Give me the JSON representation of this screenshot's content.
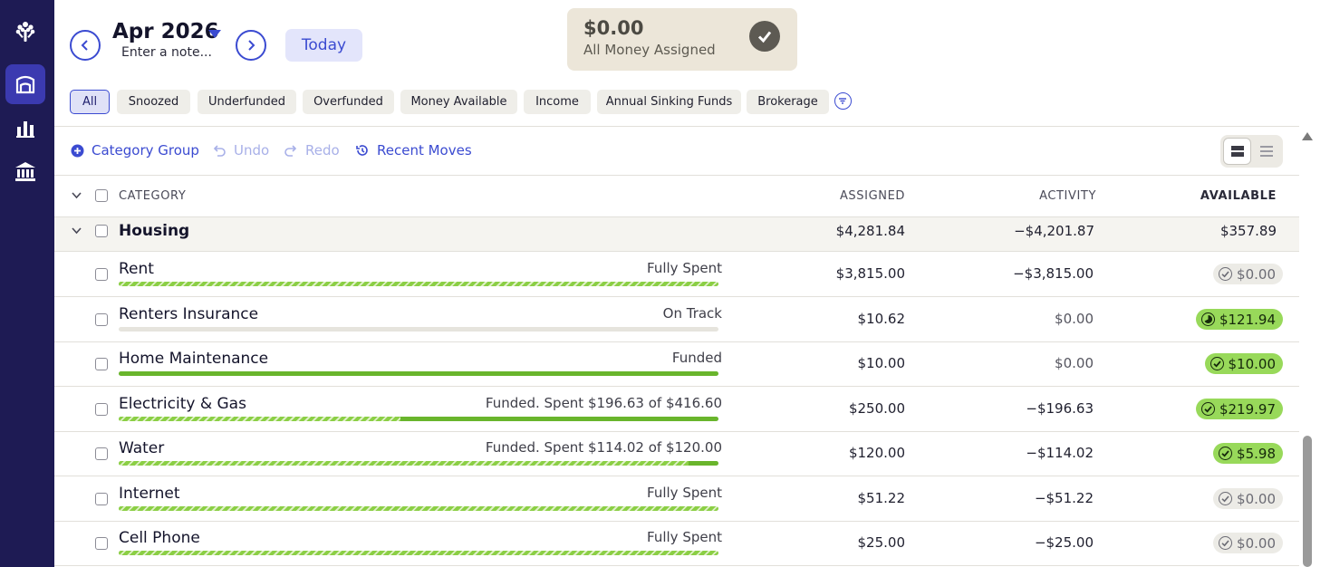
{
  "sidebar": {
    "items": [
      {
        "icon": "tree-logo-icon",
        "active": false
      },
      {
        "icon": "budget-icon",
        "active": true
      },
      {
        "icon": "reports-icon",
        "active": false
      },
      {
        "icon": "bank-icon",
        "active": false
      }
    ]
  },
  "header": {
    "month": "Apr 2026",
    "note_placeholder": "Enter a note...",
    "today_label": "Today",
    "assigned_amount": "$0.00",
    "assigned_label": "All Money Assigned"
  },
  "filters": [
    {
      "label": "All",
      "active": true
    },
    {
      "label": "Snoozed",
      "active": false
    },
    {
      "label": "Underfunded",
      "active": false
    },
    {
      "label": "Overfunded",
      "active": false
    },
    {
      "label": "Money Available",
      "active": false
    },
    {
      "label": "Income",
      "active": false
    },
    {
      "label": "Annual Sinking Funds",
      "active": false
    },
    {
      "label": "Brokerage",
      "active": false
    }
  ],
  "toolbar": {
    "category_group": "Category Group",
    "undo": "Undo",
    "redo": "Redo",
    "recent_moves": "Recent Moves"
  },
  "table": {
    "headers": {
      "category": "CATEGORY",
      "assigned": "ASSIGNED",
      "activity": "ACTIVITY",
      "available": "AVAILABLE"
    },
    "group": {
      "name": "Housing",
      "assigned": "$4,281.84",
      "activity": "−$4,201.87",
      "available": "$357.89"
    },
    "rows": [
      {
        "name": "Rent",
        "status": "Fully Spent",
        "assigned": "$3,815.00",
        "activity": "−$3,815.00",
        "available": "$0.00",
        "pill": "gray",
        "progress_striped": 1.0,
        "progress_solid": 0.0
      },
      {
        "name": "Renters Insurance",
        "status": "On Track",
        "assigned": "$10.62",
        "activity": "$0.00",
        "available": "$121.94",
        "pill": "green",
        "progress_striped": 0.0,
        "progress_solid": 0.0
      },
      {
        "name": "Home Maintenance",
        "status": "Funded",
        "assigned": "$10.00",
        "activity": "$0.00",
        "available": "$10.00",
        "pill": "green",
        "progress_striped": 0.0,
        "progress_solid": 1.0
      },
      {
        "name": "Electricity & Gas",
        "status": "Funded. Spent $196.63 of $416.60",
        "assigned": "$250.00",
        "activity": "−$196.63",
        "available": "$219.97",
        "pill": "green",
        "progress_striped": 0.47,
        "progress_solid": 0.53
      },
      {
        "name": "Water",
        "status": "Funded. Spent $114.02 of $120.00",
        "assigned": "$120.00",
        "activity": "−$114.02",
        "available": "$5.98",
        "pill": "green",
        "progress_striped": 0.95,
        "progress_solid": 0.05
      },
      {
        "name": "Internet",
        "status": "Fully Spent",
        "assigned": "$51.22",
        "activity": "−$51.22",
        "available": "$0.00",
        "pill": "gray",
        "progress_striped": 1.0,
        "progress_solid": 0.0
      },
      {
        "name": "Cell Phone",
        "status": "Fully Spent",
        "assigned": "$25.00",
        "activity": "−$25.00",
        "available": "$0.00",
        "pill": "gray",
        "progress_striped": 1.0,
        "progress_solid": 0.0
      }
    ]
  }
}
